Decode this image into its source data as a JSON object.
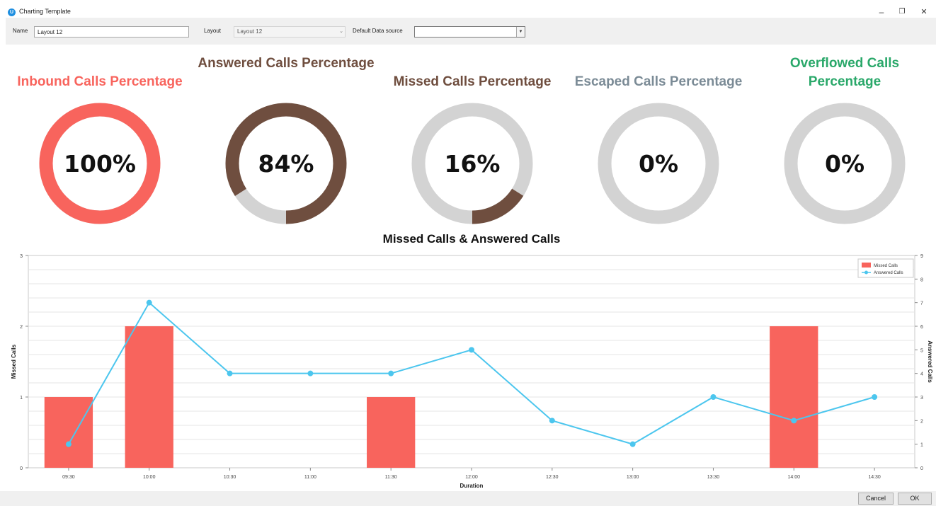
{
  "window": {
    "title": "Charting Template",
    "minimize_glyph": "–",
    "restore_glyph": "❐",
    "close_glyph": "✕"
  },
  "toolbar": {
    "name_label": "Name",
    "name_value": "Layout 12",
    "layout_label": "Layout",
    "layout_value": "Layout 12",
    "datasource_label": "Default Data source",
    "datasource_value": ""
  },
  "kpis": [
    {
      "title": "Inbound Calls Percentage",
      "value_text": "100%",
      "percent": 100,
      "color": "#f8645d",
      "track": "#d3d3d3"
    },
    {
      "title": "Answered Calls Percentage",
      "value_text": "84%",
      "percent": 84,
      "color": "#6f4e3f",
      "track": "#d3d3d3"
    },
    {
      "title": "Missed Calls Percentage",
      "value_text": "16%",
      "percent": 16,
      "color": "#6f4e3f",
      "track": "#d3d3d3"
    },
    {
      "title": "Escaped Calls Percentage",
      "value_text": "0%",
      "percent": 0,
      "color": "#7b8b96",
      "track": "#d3d3d3"
    },
    {
      "title": "Overflowed Calls Percentage",
      "value_text": "0%",
      "percent": 0,
      "color": "#2aa86a",
      "track": "#d3d3d3"
    }
  ],
  "kpi_title_colors": [
    "#f8645d",
    "#6f4e3f",
    "#6f4e3f",
    "#7b8b96",
    "#2aa86a"
  ],
  "chart_data": {
    "type": "bar",
    "title": "Missed Calls & Answered Calls",
    "xlabel": "Duration",
    "ylabel": "Missed Calls",
    "y2label": "Answered Calls",
    "categories": [
      "09:30",
      "10:00",
      "10:30",
      "11:00",
      "11:30",
      "12:00",
      "12:30",
      "13:00",
      "13:30",
      "14:00",
      "14:30"
    ],
    "ylim": [
      0,
      3
    ],
    "y2lim": [
      0,
      9
    ],
    "yticks": [
      0,
      1,
      2,
      3
    ],
    "y2ticks": [
      0,
      1,
      2,
      3,
      4,
      5,
      6,
      7,
      8,
      9
    ],
    "grid": true,
    "legend_position": "top-right",
    "series": [
      {
        "name": "Missed Calls",
        "type": "bar",
        "axis": "left",
        "color": "#f8645d",
        "values": [
          1,
          2,
          0,
          0,
          1,
          0,
          0,
          0,
          0,
          2,
          0
        ]
      },
      {
        "name": "Answered Calls",
        "type": "line",
        "axis": "right",
        "color": "#4cc6ee",
        "values": [
          1,
          7,
          4,
          4,
          4,
          5,
          2,
          1,
          3,
          2,
          3
        ]
      }
    ]
  },
  "footer": {
    "cancel_label": "Cancel",
    "ok_label": "OK"
  }
}
